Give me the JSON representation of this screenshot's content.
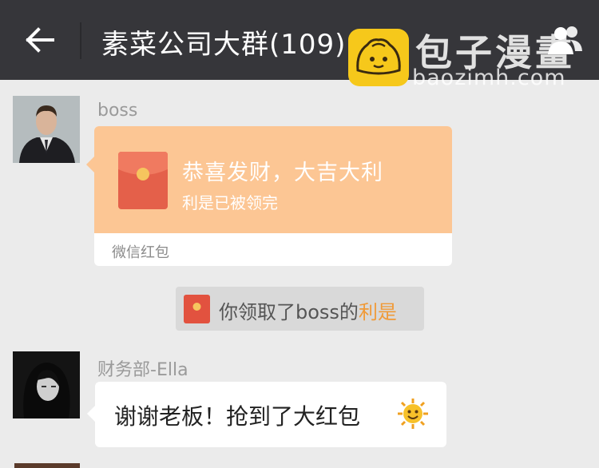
{
  "header": {
    "title": "素菜公司大群(109)",
    "back_icon": "arrow-left-icon",
    "contacts_icon": "group-contacts-icon"
  },
  "watermark": {
    "brand": "包子漫畫",
    "domain": "baozimh.com"
  },
  "messages": [
    {
      "sender": "boss",
      "type": "red-packet",
      "wish": "恭喜发财，大吉大利",
      "status": "利是已被领完",
      "footer": "微信红包"
    },
    {
      "type": "system",
      "text_prefix": "你领取了boss的",
      "text_link": "利是"
    },
    {
      "sender": "财务部-Ella",
      "type": "text",
      "text": "谢谢老板！抢到了大红包",
      "emoji": "sun-emoji"
    }
  ],
  "colors": {
    "header_bg": "#36363a",
    "chat_bg": "#ebebeb",
    "redpacket_bg": "#fcc694",
    "link": "#f09a38"
  }
}
